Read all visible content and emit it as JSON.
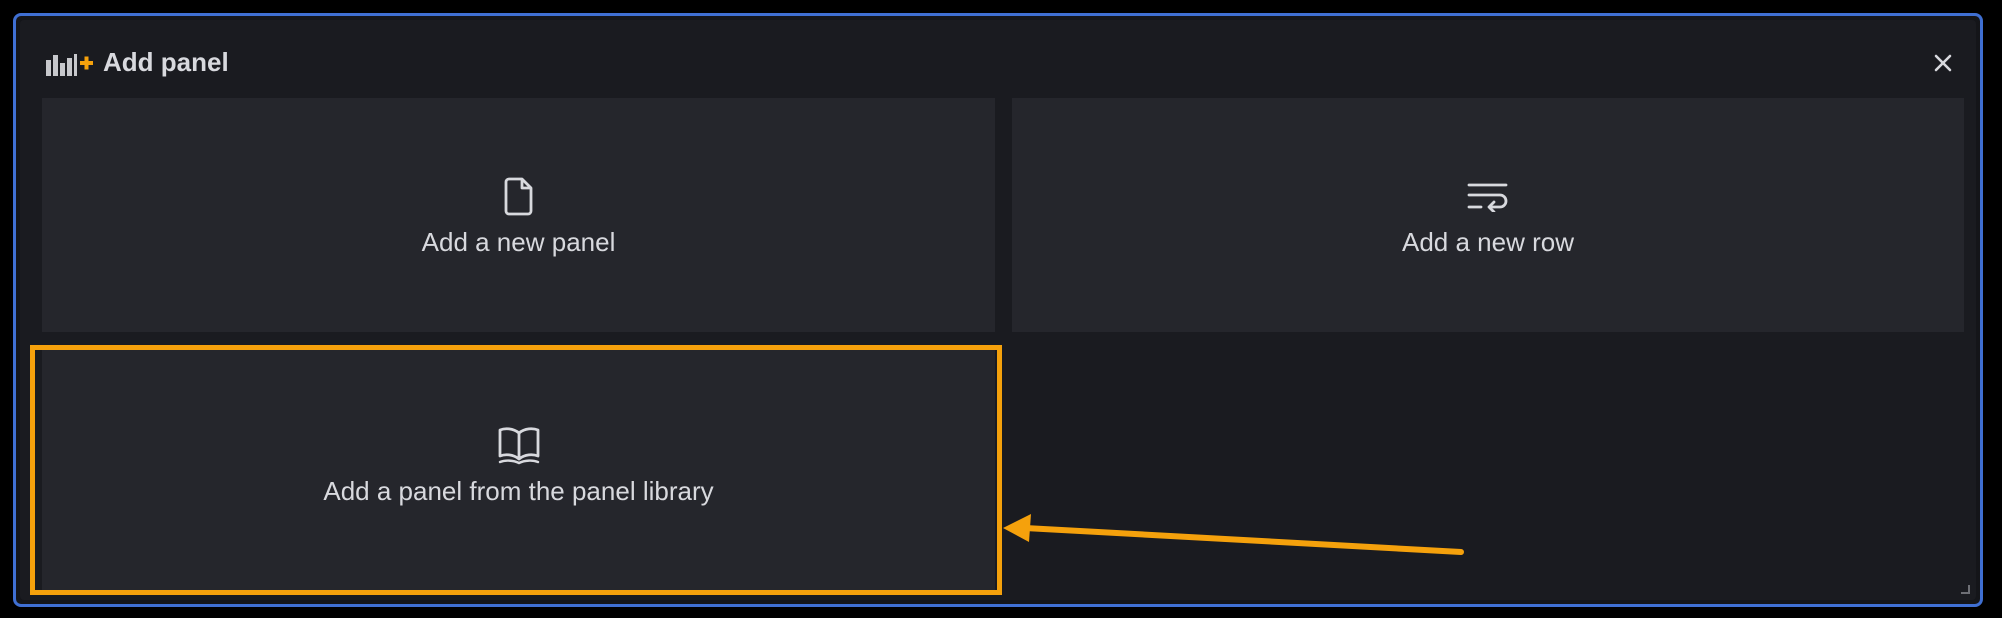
{
  "dialog": {
    "title": "Add panel",
    "title_icon": "panel-add-icon",
    "close_icon": "close-icon"
  },
  "options": [
    {
      "label": "Add a new panel",
      "icon": "file-icon"
    },
    {
      "label": "Add a new row",
      "icon": "wrap-text-icon"
    },
    {
      "label": "Add a panel from the panel library",
      "icon": "book-open-icon"
    }
  ],
  "annotation": {
    "highlighted_option": "Add a panel from the panel library",
    "highlight_color": "#f5a10c",
    "arrow_color": "#f5a10c"
  },
  "colors": {
    "border_accent": "#3f6fd2",
    "background": "#1a1b20",
    "card": "#25262c",
    "text": "#d8d9de",
    "brand_orange": "#f5a10c"
  }
}
